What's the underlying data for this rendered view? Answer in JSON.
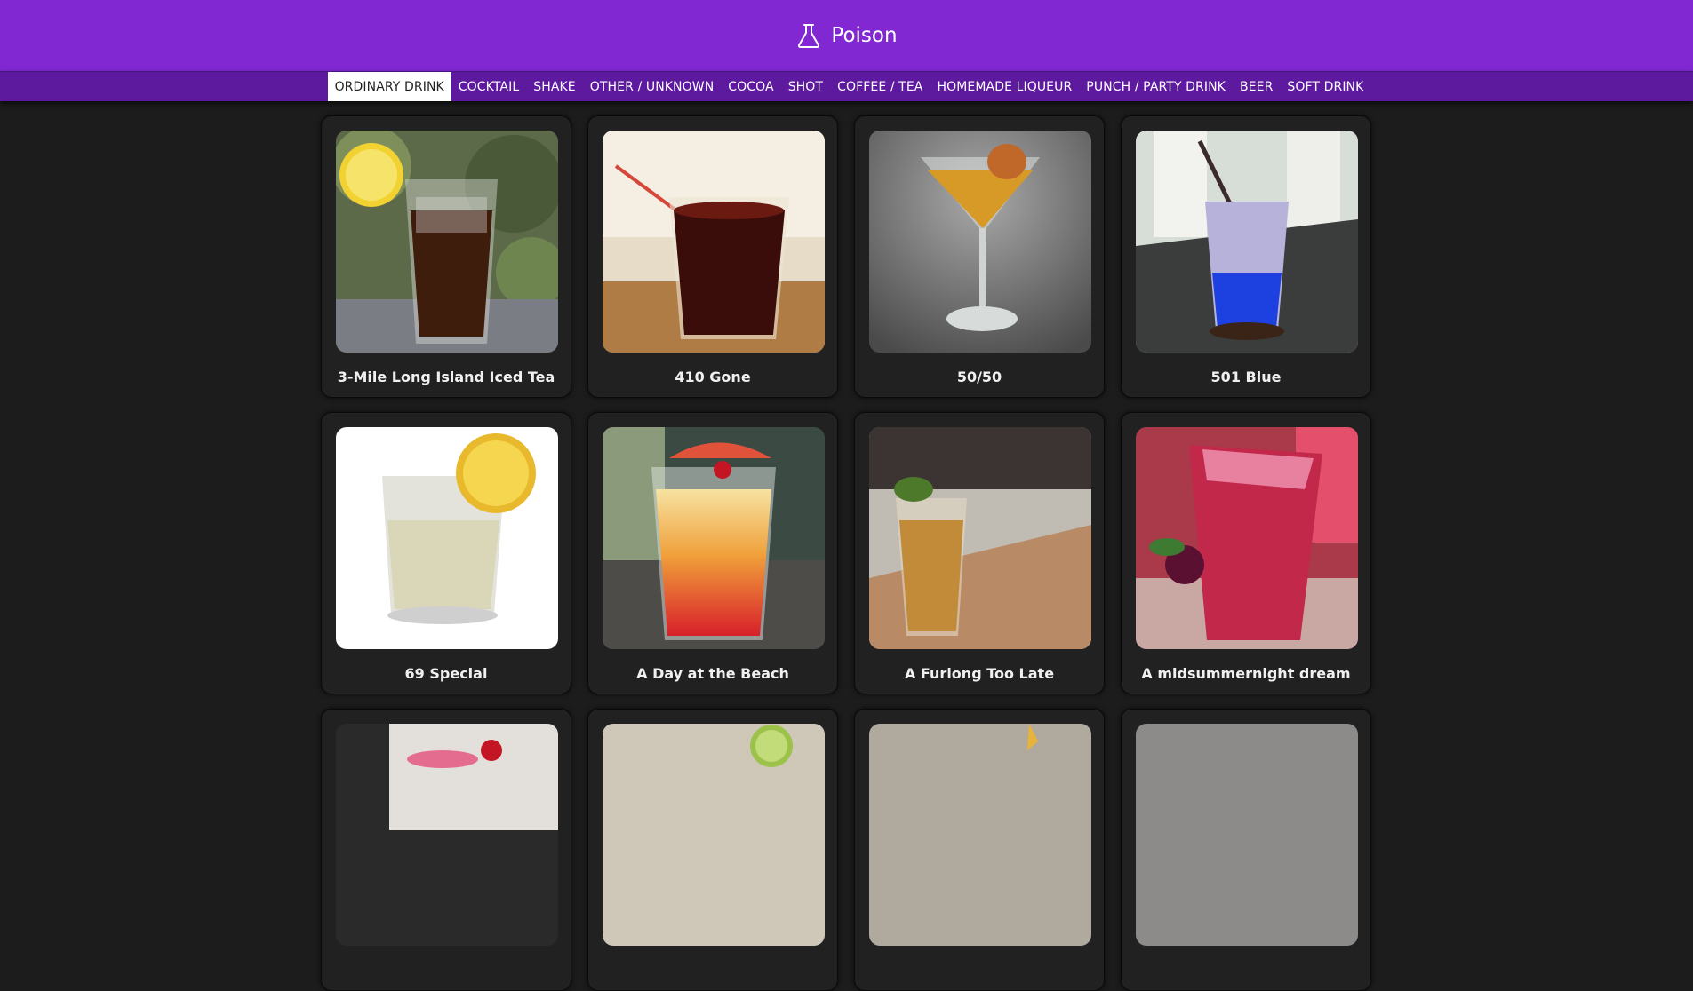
{
  "app": {
    "title": "Poison"
  },
  "nav": {
    "tabs": [
      {
        "label": "ORDINARY DRINK",
        "active": true
      },
      {
        "label": "COCKTAIL",
        "active": false
      },
      {
        "label": "SHAKE",
        "active": false
      },
      {
        "label": "OTHER / UNKNOWN",
        "active": false
      },
      {
        "label": "COCOA",
        "active": false
      },
      {
        "label": "SHOT",
        "active": false
      },
      {
        "label": "COFFEE / TEA",
        "active": false
      },
      {
        "label": "HOMEMADE LIQUEUR",
        "active": false
      },
      {
        "label": "PUNCH / PARTY DRINK",
        "active": false
      },
      {
        "label": "BEER",
        "active": false
      },
      {
        "label": "SOFT DRINK",
        "active": false
      }
    ]
  },
  "drinks": [
    {
      "name": "3-Mile Long Island Iced Tea"
    },
    {
      "name": "410 Gone"
    },
    {
      "name": "50/50"
    },
    {
      "name": "501 Blue"
    },
    {
      "name": "69 Special"
    },
    {
      "name": "A Day at the Beach"
    },
    {
      "name": "A Furlong Too Late"
    },
    {
      "name": "A midsummernight dream"
    },
    {
      "name": ""
    },
    {
      "name": ""
    },
    {
      "name": ""
    },
    {
      "name": ""
    }
  ],
  "theme": {
    "header": "#8128d3",
    "tabs_bar": "#5e1a9e",
    "background": "#1c1c1c",
    "card": "#212121"
  }
}
